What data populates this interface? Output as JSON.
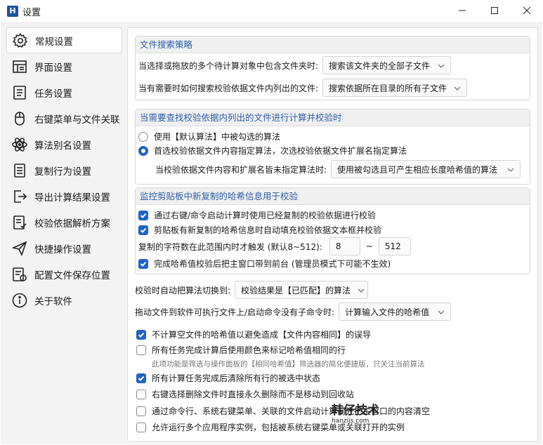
{
  "window": {
    "app_icon_letter": "H",
    "title": "设置"
  },
  "nav": {
    "items": [
      {
        "label": "常规设置",
        "icon": "gear-icon",
        "active": true
      },
      {
        "label": "界面设置",
        "icon": "layout-icon"
      },
      {
        "label": "任务设置",
        "icon": "task-list-icon"
      },
      {
        "label": "右键菜单与文件关联",
        "icon": "mouse-icon"
      },
      {
        "label": "算法别名设置",
        "icon": "atom-icon"
      },
      {
        "label": "复制行为设置",
        "icon": "copy-doc-icon"
      },
      {
        "label": "导出计算结果设置",
        "icon": "export-icon"
      },
      {
        "label": "校验依据解析方案",
        "icon": "checklist-icon"
      },
      {
        "label": "快捷操作设置",
        "icon": "send-icon"
      },
      {
        "label": "配置文件保存位置",
        "icon": "save-config-icon"
      },
      {
        "label": "关于软件",
        "icon": "info-icon"
      }
    ]
  },
  "search_strategy": {
    "header": "文件搜索策略",
    "row1_label": "当选择或拖放的多个待计算对象中包含文件夹时:",
    "row1_value": "搜索该文件夹的全部子文件",
    "row2_label": "当有需要时如何搜索校验依据文件内列出的文件:",
    "row2_value": "搜索依据所在目录的所有子文件"
  },
  "algo_strategy": {
    "header": "当需要查找校验依据内列出的文件进行计算并校验时",
    "option1": "使用【默认算法】中被勾选的算法",
    "option2": "首选校验依据文件内容指定算法，次选校验依据文件扩展名指定算法",
    "row_label": "当校验依据文件内容和扩展名皆未指定算法时:",
    "row_value": "使用被勾选且可产生相应长度哈希值的算法"
  },
  "clipboard": {
    "header": "监控剪贴板中新复制的哈希信息用于校验",
    "check1": "通过右键/命令启动计算时使用已经复制的校验依据进行校验",
    "check2": "剪贴板有新复制的哈希信息时自动填充校验依据文本框并校验",
    "range_label": "复制的字符数在此范围内时才触发 (默认8~512):",
    "range_min": "8",
    "range_sep": "~",
    "range_max": "512",
    "check3": "完成哈希值校验后把主窗口带到前台 (管理员模式下可能不生效)"
  },
  "general": {
    "auto_switch_label": "校验时自动把算法切换到:",
    "auto_switch_value": "校验结果是【已匹配】的算法",
    "drag_label": "拖动文件到软件可执行文件上/启动命令没有子命令时:",
    "drag_value": "计算输入文件的哈希值",
    "opt1": "不计算空文件的哈希值以避免造成【文件内容相同】的误导",
    "opt2": "所有任务完成计算后使用颜色来标记哈希值相同的行",
    "opt2_note": "此项功能是筛选与操作面板的【相同哈希值】筛选器的简化便捷版，只关注当前算法",
    "opt3": "所有计算任务完成后清除所有行的被选中状态",
    "opt4": "右键选择删除文件时直接永久删除而不是移动到回收站",
    "opt5": "通过命令行、系统右键菜单、关联的文件启动计算前先把主窗口的内容清空",
    "opt6": "允许运行多个应用程序实例，包括被系统右键菜单或关联打开的实例"
  },
  "watermark": {
    "text": "韩仔技术",
    "url": "hanzijs.com"
  }
}
